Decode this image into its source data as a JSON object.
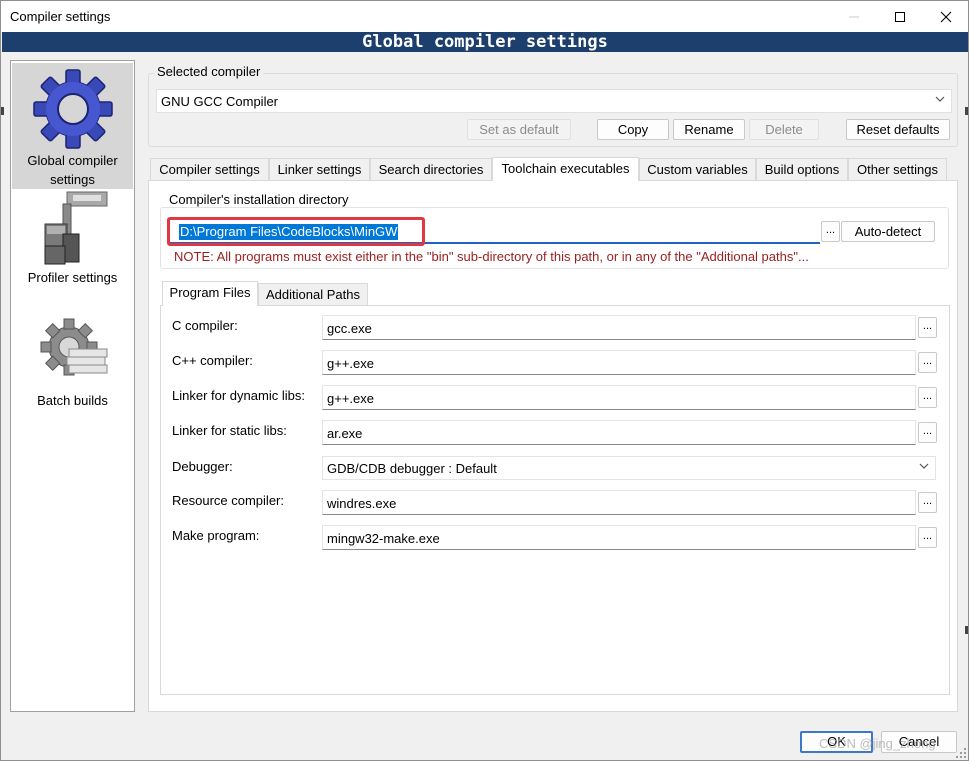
{
  "window": {
    "title": "Compiler settings"
  },
  "banner": "Global compiler settings",
  "sidebar": {
    "items": [
      {
        "label_line1": "Global compiler",
        "label_line2": "settings",
        "icon": "gear-icon",
        "selected": true
      },
      {
        "label": "Profiler settings",
        "icon": "profiler-icon"
      },
      {
        "label": "Batch builds",
        "icon": "batch-gear-icon"
      }
    ]
  },
  "selected_compiler": {
    "group_title": "Selected compiler",
    "value": "GNU GCC Compiler",
    "buttons": {
      "set_as_default": "Set as default",
      "copy": "Copy",
      "rename": "Rename",
      "delete": "Delete",
      "reset_defaults": "Reset defaults"
    }
  },
  "tabs": [
    "Compiler settings",
    "Linker settings",
    "Search directories",
    "Toolchain executables",
    "Custom variables",
    "Build options",
    "Other settings"
  ],
  "active_tab": "Toolchain executables",
  "install_dir": {
    "group_title": "Compiler's installation directory",
    "value": "D:\\Program Files\\CodeBlocks\\MinGW",
    "browse": "...",
    "auto_detect": "Auto-detect",
    "note": "NOTE: All programs must exist either in the \"bin\" sub-directory of this path, or in any of the \"Additional paths\"..."
  },
  "subtabs": [
    "Program Files",
    "Additional Paths"
  ],
  "programs": {
    "c_compiler": {
      "label": "C compiler:",
      "value": "gcc.exe"
    },
    "cpp_compiler": {
      "label": "C++ compiler:",
      "value": "g++.exe"
    },
    "linker_dynamic": {
      "label": "Linker for dynamic libs:",
      "value": "g++.exe"
    },
    "linker_static": {
      "label": "Linker for static libs:",
      "value": "ar.exe"
    },
    "debugger": {
      "label": "Debugger:",
      "value": "GDB/CDB debugger : Default"
    },
    "resource_compiler": {
      "label": "Resource compiler:",
      "value": "windres.exe"
    },
    "make_program": {
      "label": "Make program:",
      "value": "mingw32-make.exe"
    },
    "browse": "..."
  },
  "footer": {
    "ok": "OK",
    "cancel": "Cancel"
  },
  "watermark": "CSDN @jing_zhong",
  "colors": {
    "banner": "#1c3f6e",
    "note": "#9b1e1e",
    "selection": "#0078d7",
    "highlight_box": "#e0383e"
  }
}
